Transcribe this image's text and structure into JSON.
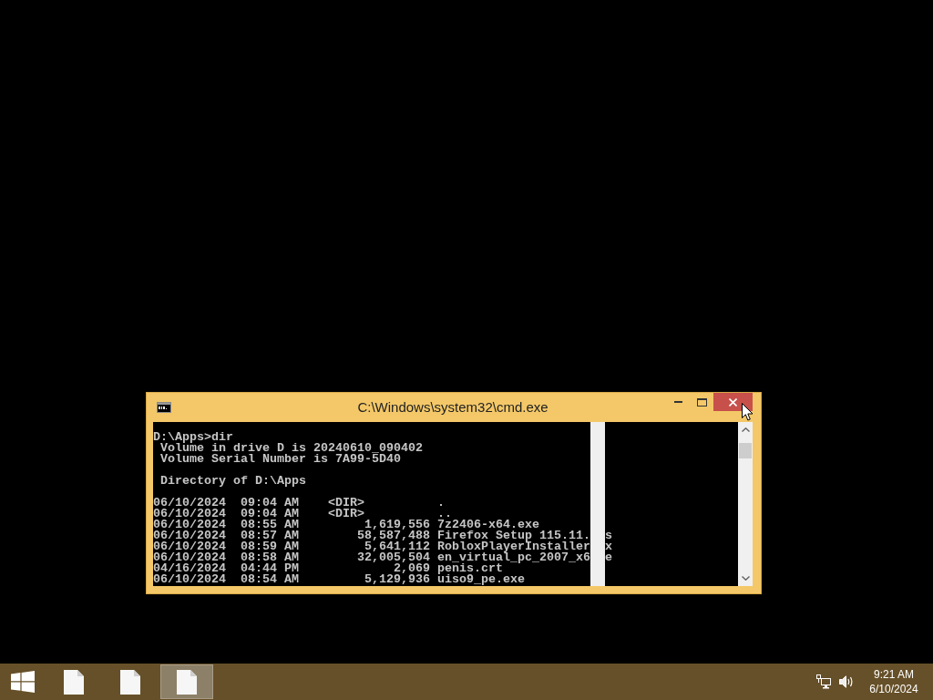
{
  "window": {
    "title": "C:\\Windows\\system32\\cmd.exe",
    "close_button": {
      "hovered": true
    }
  },
  "console": {
    "blocks": [
      [
        {
          "text": "D:\\Apps>dir"
        },
        {
          "text": " Volume in drive D is 20240610_090402"
        },
        {
          "text": " Volume Serial Number is 7A99-5D40"
        }
      ],
      [
        {
          "text": " Directory of D:\\Apps"
        }
      ],
      [
        {
          "text": "06/10/2024  09:04 AM    <DIR>          ."
        },
        {
          "text": "06/10/2024  09:04 AM    <DIR>          .."
        },
        {
          "text": "06/10/2024  08:55 AM         1,619,556 7z2406-x64.exe"
        },
        {
          "text": "06/10/2024  08:57 AM        58,587,488 Firefox Setup 115.11.",
          "text_after_gap": "s"
        },
        {
          "text": "06/10/2024  08:59 AM         5,641,112 RobloxPlayerInstaller",
          "text_after_gap": "x"
        },
        {
          "text": "06/10/2024  08:58 AM        32,005,504 en_virtual_pc_2007_x6",
          "text_after_gap": "e"
        },
        {
          "text": "04/16/2024  04:44 PM             2,069 penis.crt"
        },
        {
          "text": "06/10/2024  08:54 AM         5,129,936 uiso9_pe.exe"
        }
      ]
    ]
  },
  "taskbar": {
    "items": [
      {
        "selected": false
      },
      {
        "selected": false
      },
      {
        "selected": true
      }
    ],
    "clock": {
      "time": "9:21 AM",
      "date": "6/10/2024"
    }
  }
}
